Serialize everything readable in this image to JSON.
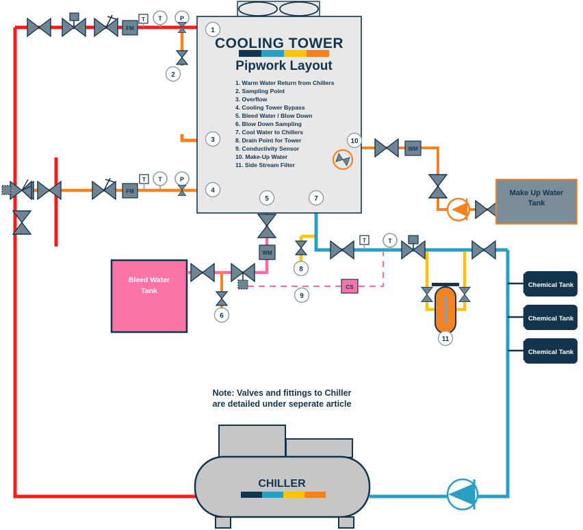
{
  "palette": {
    "navy": "#12344d",
    "teal": "#2a9fc4",
    "yellow": "#ffc40a",
    "orange": "#f58220",
    "red": "#fb1a1a",
    "pink": "#fb6ba0",
    "pink_tank": "#fb74a7",
    "steel": "#6f8593",
    "tower_fill": "#e8e8e8",
    "tank_grey": "#7a8d99",
    "chiller_grey": "#c6c6c6",
    "white": "#ffffff"
  },
  "tower": {
    "title": "COOLING TOWER",
    "subtitle": "Pipwork Layout",
    "colorbar": [
      "#12344d",
      "#2a9fc4",
      "#ffc40a",
      "#f58220"
    ],
    "legend": [
      "1. Warm Water Return from Chillers",
      "2. Sampling Point",
      "3. Overflow",
      "4. Cooling Tower Bypass",
      "5. Bleed Water / Blow Down",
      "6. Blow Down Sampling",
      "7. Cool Water to Chillers",
      "8. Drain Point for Tower",
      "9. Conductivity Sensor",
      "10. Make-Up Water",
      "11. Side Stream Filter"
    ]
  },
  "callouts": {
    "c1": "1",
    "c2": "2",
    "c3": "3",
    "c4": "4",
    "c5": "5",
    "c6": "6",
    "c7": "7",
    "c8": "8",
    "c9": "9",
    "c10": "10",
    "c11": "11"
  },
  "instruments": {
    "thermowell_label": "T",
    "temp_gauge_label": "T",
    "pressure_gauge_label": "P",
    "flow_meter_label": "FM",
    "water_meter_label": "WM",
    "conductivity_label": "CS"
  },
  "tanks": {
    "bleed_water": "Bleed Water\nTank",
    "bleed_water_line1": "Bleed Water",
    "bleed_water_line2": "Tank",
    "make_up_water_line1": "Make Up Water",
    "make_up_water_line2": "Tank",
    "chemical": "Chemical Tank"
  },
  "chiller": {
    "label": "CHILLER",
    "colorbar": [
      "#12344d",
      "#2a9fc4",
      "#ffc40a",
      "#f58220"
    ],
    "note_line1": "Note: Valves and fittings to Chiller",
    "note_line2": "are detailed under seperate article"
  },
  "chart_data": {
    "type": "table",
    "title": "COOLING TOWER Pipwork Layout",
    "categories": [
      "Warm Water Return from Chillers",
      "Sampling Point",
      "Overflow",
      "Cooling Tower Bypass",
      "Bleed Water / Blow Down",
      "Blow Down Sampling",
      "Cool Water to Chillers",
      "Drain Point for Tower",
      "Conductivity Sensor",
      "Make-Up Water",
      "Side Stream Filter"
    ],
    "values": [
      1,
      2,
      3,
      4,
      5,
      6,
      7,
      8,
      9,
      10,
      11
    ]
  }
}
